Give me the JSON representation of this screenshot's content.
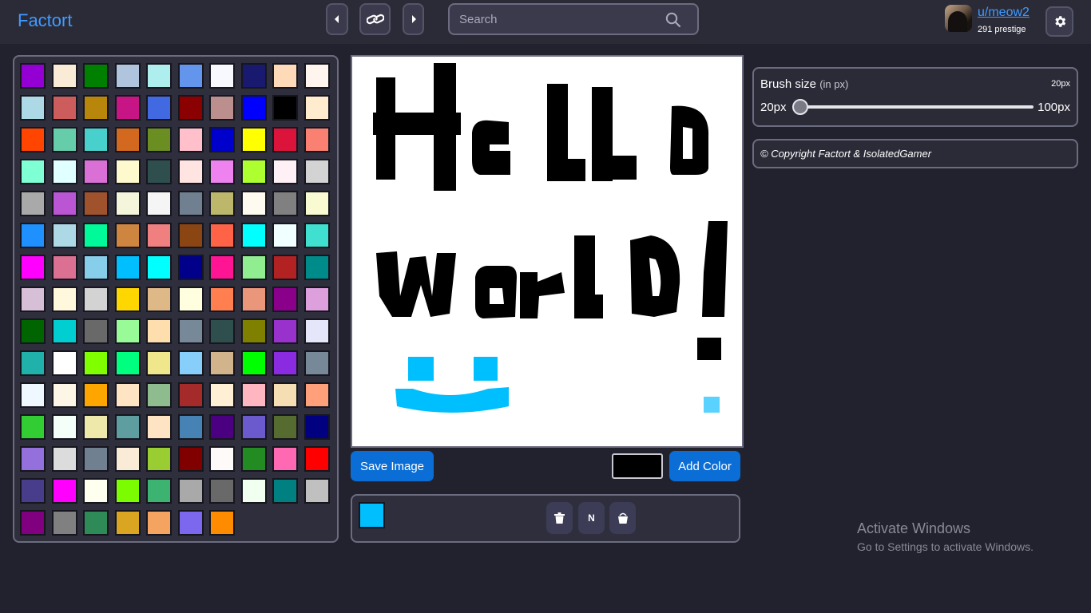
{
  "brand": "Factort",
  "search": {
    "placeholder": "Search"
  },
  "user": {
    "name": "u/meow2",
    "prestige": "291 prestige"
  },
  "palette": {
    "colors": [
      "#9400d3",
      "#faebd7",
      "#008000",
      "#b0c4de",
      "#afeeee",
      "#6495ed",
      "#f8f8ff",
      "#191970",
      "#ffdab9",
      "#fff5ee",
      "#add8e6",
      "#cd5c5c",
      "#b8860b",
      "#c71585",
      "#4169e1",
      "#8b0000",
      "#bc8f8f",
      "#0000ff",
      "#000000",
      "#ffebcd",
      "#ff4500",
      "#66cdaa",
      "#48d1cc",
      "#d2691e",
      "#6b8e23",
      "#ffc0cb",
      "#0000cd",
      "#ffff00",
      "#dc143c",
      "#fa8072",
      "#7fffd4",
      "#e0ffff",
      "#da70d6",
      "#fffacd",
      "#2f4f4f",
      "#ffe4e1",
      "#ee82ee",
      "#adff2f",
      "#fff0f5",
      "#d3d3d3",
      "#a9a9a9",
      "#ba55d3",
      "#a0522d",
      "#f5f5dc",
      "#f5f5f5",
      "#708090",
      "#bdb76b",
      "#fffaf0",
      "#808080",
      "#fafad2",
      "#1e90ff",
      "#add8e6",
      "#00fa9a",
      "#cd853f",
      "#f08080",
      "#8b4513",
      "#ff6347",
      "#00ffff",
      "#f0ffff",
      "#40e0d0",
      "#ff00ff",
      "#db7093",
      "#87ceeb",
      "#00bfff",
      "#00ffff",
      "#00008b",
      "#ff1493",
      "#90ee90",
      "#b22222",
      "#008b8b",
      "#d8bfd8",
      "#fff8dc",
      "#d3d3d3",
      "#ffd700",
      "#deb887",
      "#ffffe0",
      "#ff7f50",
      "#e9967a",
      "#8b008b",
      "#dda0dd",
      "#006400",
      "#00ced1",
      "#696969",
      "#98fb98",
      "#ffdead",
      "#778899",
      "#2f4f4f",
      "#808000",
      "#9932cc",
      "#e6e6fa",
      "#20b2aa",
      "#ffffff",
      "#7fff00",
      "#00ff7f",
      "#f0e68c",
      "#87cefa",
      "#d2b48c",
      "#00ff00",
      "#8a2be2",
      "#778899",
      "#f0f8ff",
      "#fdf5e6",
      "#ffa500",
      "#ffe4c4",
      "#8fbc8f",
      "#a52a2a",
      "#ffefd5",
      "#ffb6c1",
      "#f5deb3",
      "#ffa07a",
      "#32cd32",
      "#f5fffa",
      "#eee8aa",
      "#5f9ea0",
      "#ffe4c4",
      "#4682b4",
      "#4b0082",
      "#6a5acd",
      "#556b2f",
      "#000080",
      "#9370db",
      "#dcdcdc",
      "#708090",
      "#faebd7",
      "#9acd32",
      "#800000",
      "#fffafa",
      "#228b22",
      "#ff69b4",
      "#ff0000",
      "#483d8b",
      "#ff00ff",
      "#fffff0",
      "#7cfc00",
      "#3cb371",
      "#a9a9a9",
      "#696969",
      "#f0fff0",
      "#008080",
      "#c0c0c0",
      "#800080",
      "#808080",
      "#2e8b57",
      "#daa520",
      "#f4a460",
      "#7b68ee",
      "#ff8c00"
    ]
  },
  "canvas": {
    "background": "#ffffff",
    "ink": "#000000",
    "smile_color": "#00bfff",
    "dot_color": "#5ad2ff"
  },
  "actions": {
    "save_label": "Save Image",
    "add_color_label": "Add Color",
    "color_value": "#000000"
  },
  "tools": {
    "current_color": "#00bfff",
    "new_label": "N"
  },
  "brush": {
    "title": "Brush size",
    "unit": "(in px)",
    "current": "20px",
    "min_label": "20px",
    "max_label": "100px",
    "min": 20,
    "max": 100,
    "value": 20
  },
  "copyright": "© Copyright Factort & IsolatedGamer",
  "watermark": {
    "title": "Activate Windows",
    "subtitle": "Go to Settings to activate Windows."
  }
}
